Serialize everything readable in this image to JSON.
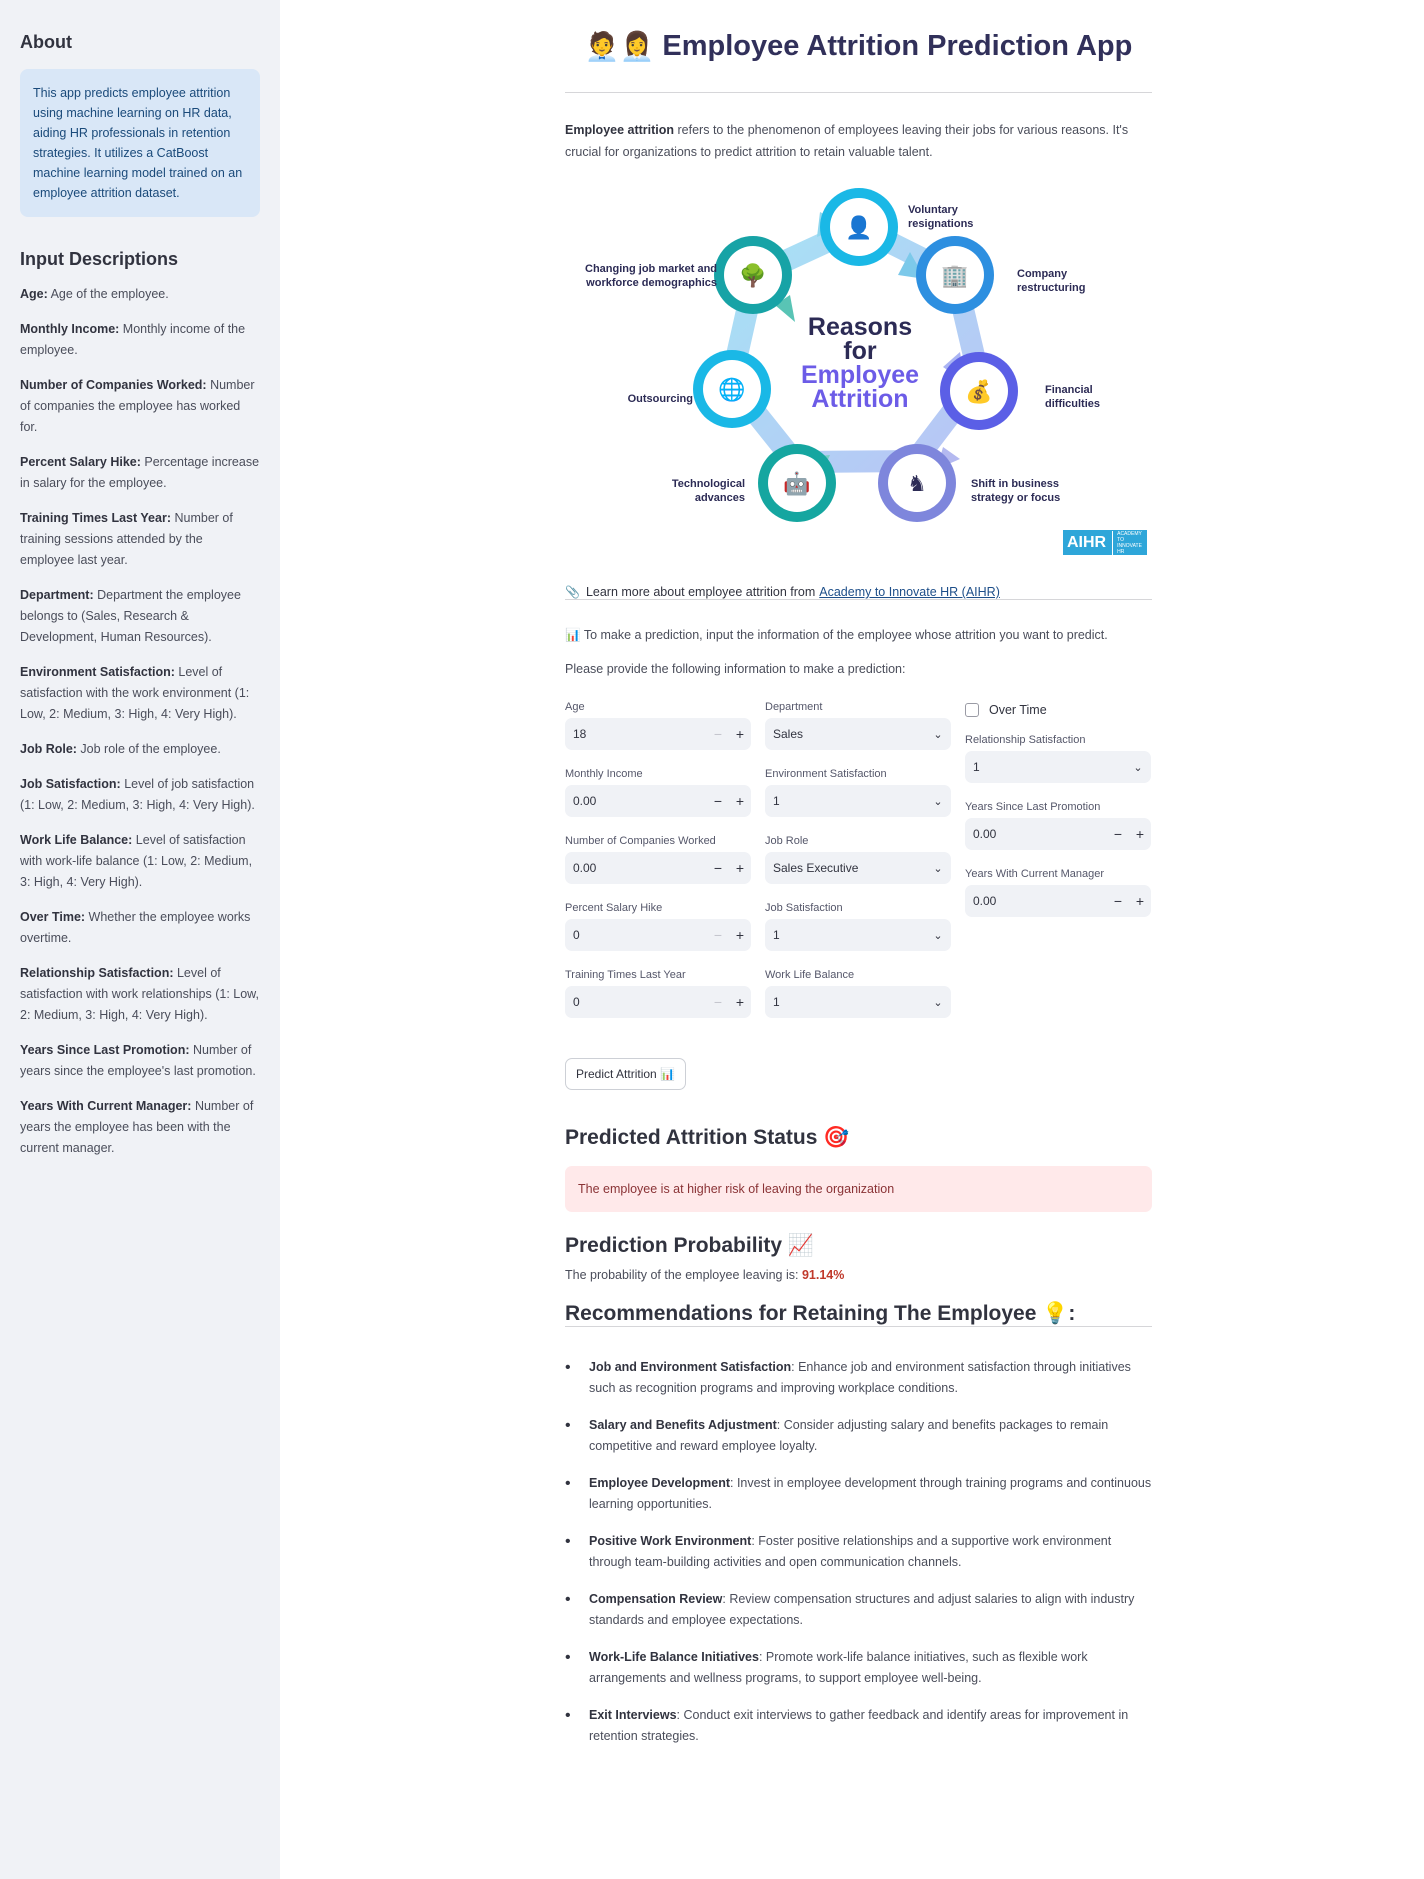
{
  "sidebar": {
    "about_title": "About",
    "about_text": "This app predicts employee attrition using machine learning on HR data, aiding HR professionals in retention strategies. It utilizes a CatBoost machine learning model trained on an employee attrition dataset.",
    "desc_title": "Input Descriptions",
    "items": [
      {
        "term": "Age:",
        "text": " Age of the employee."
      },
      {
        "term": "Monthly Income:",
        "text": " Monthly income of the employee."
      },
      {
        "term": "Number of Companies Worked:",
        "text": " Number of companies the employee has worked for."
      },
      {
        "term": "Percent Salary Hike:",
        "text": " Percentage increase in salary for the employee."
      },
      {
        "term": "Training Times Last Year:",
        "text": " Number of training sessions attended by the employee last year."
      },
      {
        "term": "Department:",
        "text": " Department the employee belongs to (Sales, Research & Development, Human Resources)."
      },
      {
        "term": "Environment Satisfaction:",
        "text": " Level of satisfaction with the work environment (1: Low, 2: Medium, 3: High, 4: Very High)."
      },
      {
        "term": "Job Role:",
        "text": " Job role of the employee."
      },
      {
        "term": "Job Satisfaction:",
        "text": " Level of job satisfaction (1: Low, 2: Medium, 3: High, 4: Very High)."
      },
      {
        "term": "Work Life Balance:",
        "text": " Level of satisfaction with work-life balance (1: Low, 2: Medium, 3: High, 4: Very High)."
      },
      {
        "term": "Over Time:",
        "text": " Whether the employee works overtime."
      },
      {
        "term": "Relationship Satisfaction:",
        "text": " Level of satisfaction with work relationships (1: Low, 2: Medium, 3: High, 4: Very High)."
      },
      {
        "term": "Years Since Last Promotion:",
        "text": " Number of years since the employee's last promotion."
      },
      {
        "term": "Years With Current Manager:",
        "text": " Number of years the employee has been with the current manager."
      }
    ]
  },
  "main": {
    "title_emoji": "🧑‍💼👩‍💼",
    "title": "Employee Attrition Prediction App",
    "intro_bold": "Employee attrition",
    "intro_rest": " refers to the phenomenon of employees leaving their jobs for various reasons. It's crucial for organizations to predict attrition to retain valuable talent.",
    "diagram": {
      "center_line1": "Reasons",
      "center_line2": "for",
      "center_line3": "Employee",
      "center_line4": "Attrition",
      "labels": {
        "voluntary": "Voluntary resignations",
        "company": "Company restructuring",
        "financial": "Financial difficulties",
        "shift": "Shift in business strategy or focus",
        "tech": "Technological advances",
        "outsourcing": "Outsourcing",
        "market": "Changing job market and workforce demographics"
      },
      "logo": "AIHR",
      "logo_small": "ACADEMY TO INNOVATE HR"
    },
    "learn_icon": "📎",
    "learn_text": "Learn more about employee attrition from",
    "learn_link": "Academy to Innovate HR (AIHR)",
    "prompt_icon": "📊",
    "prompt_text": "To make a prediction, input the information of the employee whose attrition you want to predict.",
    "provide_text": "Please provide the following information to make a prediction:",
    "form": {
      "age": {
        "label": "Age",
        "value": "18"
      },
      "monthly_income": {
        "label": "Monthly Income",
        "value": "0.00"
      },
      "num_companies": {
        "label": "Number of Companies Worked",
        "value": "0.00"
      },
      "salary_hike": {
        "label": "Percent Salary Hike",
        "value": "0"
      },
      "training": {
        "label": "Training Times Last Year",
        "value": "0"
      },
      "department": {
        "label": "Department",
        "value": "Sales"
      },
      "env_sat": {
        "label": "Environment Satisfaction",
        "value": "1"
      },
      "job_role": {
        "label": "Job Role",
        "value": "Sales Executive"
      },
      "job_sat": {
        "label": "Job Satisfaction",
        "value": "1"
      },
      "wlb": {
        "label": "Work Life Balance",
        "value": "1"
      },
      "over_time": {
        "label": "Over Time",
        "checked": false
      },
      "rel_sat": {
        "label": "Relationship Satisfaction",
        "value": "1"
      },
      "years_promo": {
        "label": "Years Since Last Promotion",
        "value": "0.00"
      },
      "years_mgr": {
        "label": "Years With Current Manager",
        "value": "0.00"
      }
    },
    "predict_button": "Predict Attrition 📊",
    "status_title": "Predicted Attrition Status 🎯",
    "status_text": "The employee is at higher risk of leaving the organization",
    "prob_title": "Prediction Probability 📈",
    "prob_text": "The probability of the employee leaving is: ",
    "prob_value": "91.14%",
    "rec_title": "Recommendations for Retaining The Employee 💡:",
    "recommendations": [
      {
        "term": "Job and Environment Satisfaction",
        "text": ": Enhance job and environment satisfaction through initiatives such as recognition programs and improving workplace conditions."
      },
      {
        "term": "Salary and Benefits Adjustment",
        "text": ": Consider adjusting salary and benefits packages to remain competitive and reward employee loyalty."
      },
      {
        "term": "Employee Development",
        "text": ": Invest in employee development through training programs and continuous learning opportunities."
      },
      {
        "term": "Positive Work Environment",
        "text": ": Foster positive relationships and a supportive work environment through team-building activities and open communication channels."
      },
      {
        "term": "Compensation Review",
        "text": ": Review compensation structures and adjust salaries to align with industry standards and employee expectations."
      },
      {
        "term": "Work-Life Balance Initiatives",
        "text": ": Promote work-life balance initiatives, such as flexible work arrangements and wellness programs, to support employee well-being."
      },
      {
        "term": "Exit Interviews",
        "text": ": Conduct exit interviews to gather feedback and identify areas for improvement in retention strategies."
      }
    ]
  },
  "colors": {
    "sidebar_bg": "#f0f2f6",
    "info_bg": "#d9e7f7",
    "error_bg": "#ffe9ea",
    "accent_red": "#c0392b",
    "title_color": "#31305a"
  }
}
